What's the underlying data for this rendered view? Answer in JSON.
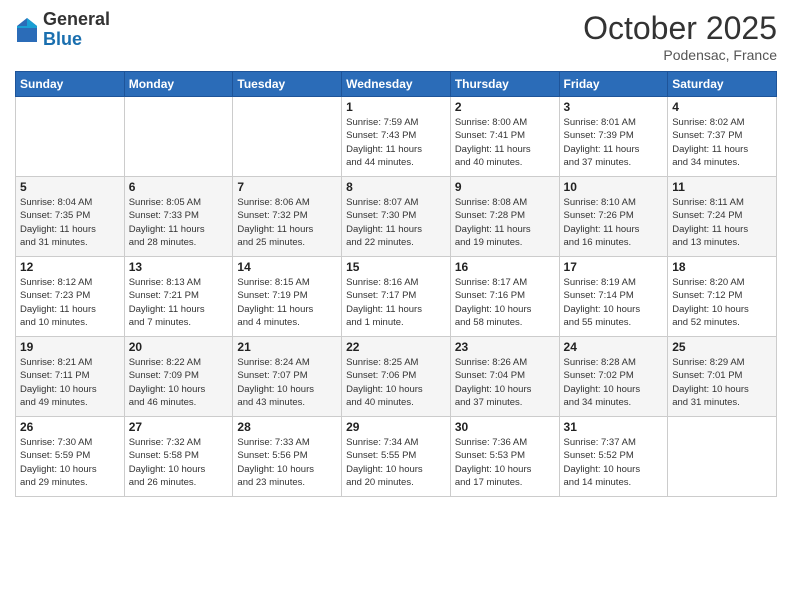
{
  "logo": {
    "general": "General",
    "blue": "Blue"
  },
  "header": {
    "month": "October 2025",
    "location": "Podensac, France"
  },
  "weekdays": [
    "Sunday",
    "Monday",
    "Tuesday",
    "Wednesday",
    "Thursday",
    "Friday",
    "Saturday"
  ],
  "weeks": [
    [
      {
        "day": "",
        "info": ""
      },
      {
        "day": "",
        "info": ""
      },
      {
        "day": "",
        "info": ""
      },
      {
        "day": "1",
        "info": "Sunrise: 7:59 AM\nSunset: 7:43 PM\nDaylight: 11 hours\nand 44 minutes."
      },
      {
        "day": "2",
        "info": "Sunrise: 8:00 AM\nSunset: 7:41 PM\nDaylight: 11 hours\nand 40 minutes."
      },
      {
        "day": "3",
        "info": "Sunrise: 8:01 AM\nSunset: 7:39 PM\nDaylight: 11 hours\nand 37 minutes."
      },
      {
        "day": "4",
        "info": "Sunrise: 8:02 AM\nSunset: 7:37 PM\nDaylight: 11 hours\nand 34 minutes."
      }
    ],
    [
      {
        "day": "5",
        "info": "Sunrise: 8:04 AM\nSunset: 7:35 PM\nDaylight: 11 hours\nand 31 minutes."
      },
      {
        "day": "6",
        "info": "Sunrise: 8:05 AM\nSunset: 7:33 PM\nDaylight: 11 hours\nand 28 minutes."
      },
      {
        "day": "7",
        "info": "Sunrise: 8:06 AM\nSunset: 7:32 PM\nDaylight: 11 hours\nand 25 minutes."
      },
      {
        "day": "8",
        "info": "Sunrise: 8:07 AM\nSunset: 7:30 PM\nDaylight: 11 hours\nand 22 minutes."
      },
      {
        "day": "9",
        "info": "Sunrise: 8:08 AM\nSunset: 7:28 PM\nDaylight: 11 hours\nand 19 minutes."
      },
      {
        "day": "10",
        "info": "Sunrise: 8:10 AM\nSunset: 7:26 PM\nDaylight: 11 hours\nand 16 minutes."
      },
      {
        "day": "11",
        "info": "Sunrise: 8:11 AM\nSunset: 7:24 PM\nDaylight: 11 hours\nand 13 minutes."
      }
    ],
    [
      {
        "day": "12",
        "info": "Sunrise: 8:12 AM\nSunset: 7:23 PM\nDaylight: 11 hours\nand 10 minutes."
      },
      {
        "day": "13",
        "info": "Sunrise: 8:13 AM\nSunset: 7:21 PM\nDaylight: 11 hours\nand 7 minutes."
      },
      {
        "day": "14",
        "info": "Sunrise: 8:15 AM\nSunset: 7:19 PM\nDaylight: 11 hours\nand 4 minutes."
      },
      {
        "day": "15",
        "info": "Sunrise: 8:16 AM\nSunset: 7:17 PM\nDaylight: 11 hours\nand 1 minute."
      },
      {
        "day": "16",
        "info": "Sunrise: 8:17 AM\nSunset: 7:16 PM\nDaylight: 10 hours\nand 58 minutes."
      },
      {
        "day": "17",
        "info": "Sunrise: 8:19 AM\nSunset: 7:14 PM\nDaylight: 10 hours\nand 55 minutes."
      },
      {
        "day": "18",
        "info": "Sunrise: 8:20 AM\nSunset: 7:12 PM\nDaylight: 10 hours\nand 52 minutes."
      }
    ],
    [
      {
        "day": "19",
        "info": "Sunrise: 8:21 AM\nSunset: 7:11 PM\nDaylight: 10 hours\nand 49 minutes."
      },
      {
        "day": "20",
        "info": "Sunrise: 8:22 AM\nSunset: 7:09 PM\nDaylight: 10 hours\nand 46 minutes."
      },
      {
        "day": "21",
        "info": "Sunrise: 8:24 AM\nSunset: 7:07 PM\nDaylight: 10 hours\nand 43 minutes."
      },
      {
        "day": "22",
        "info": "Sunrise: 8:25 AM\nSunset: 7:06 PM\nDaylight: 10 hours\nand 40 minutes."
      },
      {
        "day": "23",
        "info": "Sunrise: 8:26 AM\nSunset: 7:04 PM\nDaylight: 10 hours\nand 37 minutes."
      },
      {
        "day": "24",
        "info": "Sunrise: 8:28 AM\nSunset: 7:02 PM\nDaylight: 10 hours\nand 34 minutes."
      },
      {
        "day": "25",
        "info": "Sunrise: 8:29 AM\nSunset: 7:01 PM\nDaylight: 10 hours\nand 31 minutes."
      }
    ],
    [
      {
        "day": "26",
        "info": "Sunrise: 7:30 AM\nSunset: 5:59 PM\nDaylight: 10 hours\nand 29 minutes."
      },
      {
        "day": "27",
        "info": "Sunrise: 7:32 AM\nSunset: 5:58 PM\nDaylight: 10 hours\nand 26 minutes."
      },
      {
        "day": "28",
        "info": "Sunrise: 7:33 AM\nSunset: 5:56 PM\nDaylight: 10 hours\nand 23 minutes."
      },
      {
        "day": "29",
        "info": "Sunrise: 7:34 AM\nSunset: 5:55 PM\nDaylight: 10 hours\nand 20 minutes."
      },
      {
        "day": "30",
        "info": "Sunrise: 7:36 AM\nSunset: 5:53 PM\nDaylight: 10 hours\nand 17 minutes."
      },
      {
        "day": "31",
        "info": "Sunrise: 7:37 AM\nSunset: 5:52 PM\nDaylight: 10 hours\nand 14 minutes."
      },
      {
        "day": "",
        "info": ""
      }
    ]
  ]
}
